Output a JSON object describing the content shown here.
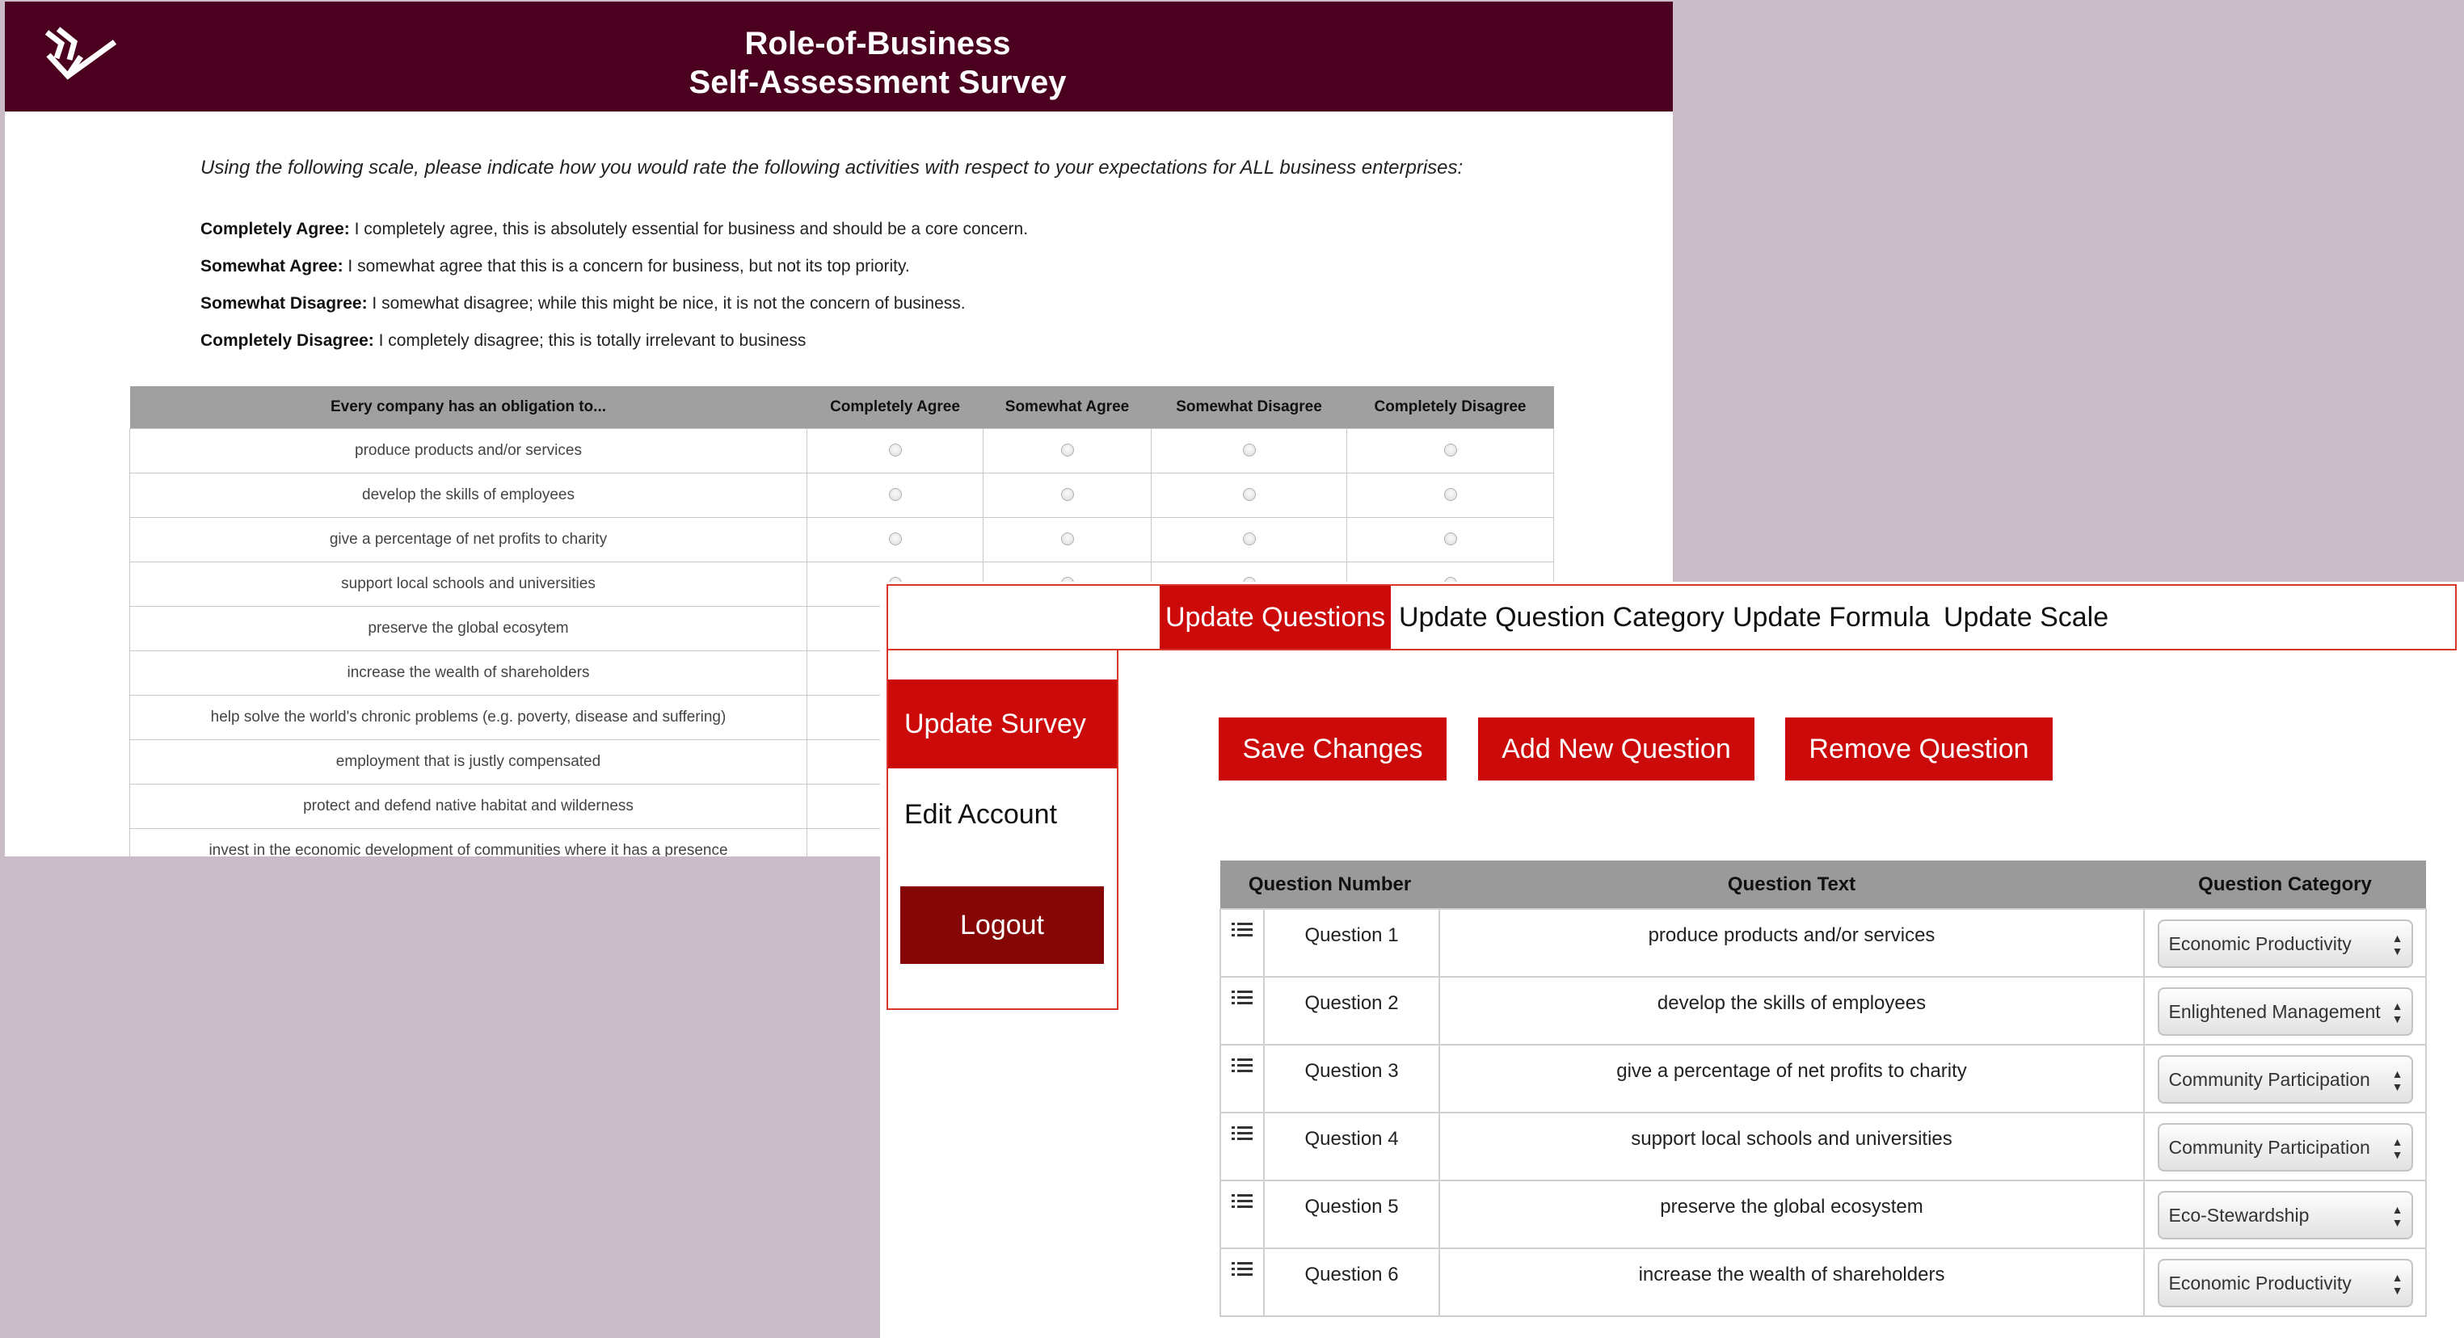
{
  "survey": {
    "title_line1": "Role-of-Business",
    "title_line2": "Self-Assessment Survey",
    "instructions": "Using the following scale, please indicate how you would rate the following activities with respect to your expectations for ALL business enterprises:",
    "scale": [
      {
        "term": "Completely Agree:",
        "desc": " I completely agree, this is absolutely essential for business and should be a core concern."
      },
      {
        "term": "Somewhat Agree:",
        "desc": " I somewhat agree that this is a concern for business, but not its top priority."
      },
      {
        "term": "Somewhat Disagree:",
        "desc": " I somewhat disagree; while this might be nice, it is not the concern of business."
      },
      {
        "term": "Completely Disagree:",
        "desc": " I completely disagree; this is totally irrelevant to business"
      }
    ],
    "table": {
      "headers": [
        "Every company has an obligation to...",
        "Completely Agree",
        "Somewhat Agree",
        "Somewhat Disagree",
        "Completely Disagree"
      ],
      "rows": [
        "produce products and/or services",
        "develop the skills of employees",
        "give a percentage of net profits to charity",
        "support local schools and universities",
        "preserve the global ecosytem",
        "increase the wealth of shareholders",
        "help solve the world's chronic problems (e.g. poverty, disease and suffering)",
        "employment that is justly compensated",
        "protect and defend native habitat and wilderness",
        "invest in the economic development of communities where it has a presence"
      ]
    }
  },
  "admin": {
    "tabs": [
      "Update Questions",
      "Update Question Category",
      "Update Formula",
      "Update Scale"
    ],
    "sidebar": {
      "items": [
        "Update Survey",
        "Edit Account"
      ],
      "logout": "Logout"
    },
    "buttons": {
      "save": "Save Changes",
      "add": "Add New Question",
      "remove": "Remove Question"
    },
    "table": {
      "headers": [
        "Question Number",
        "Question Text",
        "Question Category"
      ],
      "rows": [
        {
          "number": "Question 1",
          "text": "produce products and/or services",
          "category": "Economic Productivity"
        },
        {
          "number": "Question 2",
          "text": "develop the skills of employees",
          "category": "Enlightened Management"
        },
        {
          "number": "Question 3",
          "text": "give a percentage of net profits to charity",
          "category": "Community Participation"
        },
        {
          "number": "Question 4",
          "text": "support local schools and universities",
          "category": "Community Participation"
        },
        {
          "number": "Question 5",
          "text": "preserve the global ecosystem",
          "category": "Eco-Stewardship"
        },
        {
          "number": "Question 6",
          "text": "increase the wealth of shareholders",
          "category": "Economic Productivity"
        }
      ]
    }
  },
  "colors": {
    "header_maroon": "#4c0020",
    "accent_red": "#cc0a0a",
    "logout_dark_red": "#860606",
    "desktop_bg": "#c9bcc7",
    "table_header_gray": "#9a9a9a"
  },
  "icons": {
    "logo": "wheat-logo",
    "row_handle": "list-icon",
    "select_arrow": "updown-arrows-icon"
  }
}
